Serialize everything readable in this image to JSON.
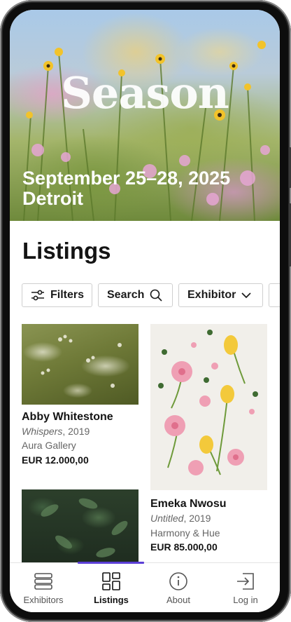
{
  "hero": {
    "logo_text": "Season",
    "dates": "September 25–28, 2025",
    "city": "Detroit"
  },
  "page_title": "Listings",
  "filters": {
    "filters_label": "Filters",
    "search_label": "Search",
    "exhibitor_label": "Exhibitor"
  },
  "listings": [
    {
      "artist": "Abby Whitestone",
      "title": "Whispers",
      "year": ", 2019",
      "gallery": "Aura Gallery",
      "price": "EUR 12.000,00",
      "image": "meadow-wildflowers"
    },
    {
      "artist": "Emeka Nwosu",
      "title": "Untitled",
      "year": ", 2019",
      "gallery": "Harmony & Hue",
      "price": "EUR 85.000,00",
      "image": "tulips-flatlay"
    },
    {
      "image": "green-leaves"
    }
  ],
  "bottom_nav": {
    "items": [
      {
        "label": "Exhibitors",
        "icon": "stack-icon"
      },
      {
        "label": "Listings",
        "icon": "grid-icon"
      },
      {
        "label": "About",
        "icon": "info-icon"
      },
      {
        "label": "Log in",
        "icon": "login-icon"
      }
    ],
    "active": "Listings",
    "accent": "#5b3fd6"
  }
}
